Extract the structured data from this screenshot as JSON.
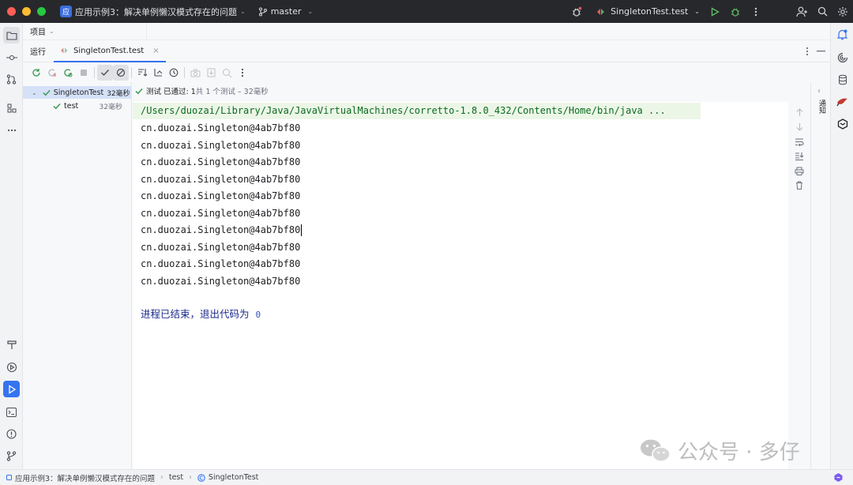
{
  "titlebar": {
    "project_badge": "应",
    "project_name": "应用示例3：解决单例懒汉模式存在的问题",
    "branch": "master",
    "run_config": "SingletonTest.test"
  },
  "project_panel": {
    "label": "项目"
  },
  "run_panel": {
    "label": "运行",
    "tab_label": "SingletonTest.test",
    "tab_close": "×"
  },
  "test_tree": [
    {
      "name": "SingletonTest",
      "time": "32毫秒"
    },
    {
      "name": "test",
      "time": "32毫秒"
    }
  ],
  "summary": {
    "status": "测试 已通过: 1",
    "detail": "共 1 个测试 – 32毫秒"
  },
  "console": {
    "command": "/Users/duozai/Library/Java/JavaVirtualMachines/corretto-1.8.0_432/Contents/Home/bin/java ...",
    "lines": [
      "cn.duozai.Singleton@4ab7bf80",
      "cn.duozai.Singleton@4ab7bf80",
      "cn.duozai.Singleton@4ab7bf80",
      "cn.duozai.Singleton@4ab7bf80",
      "cn.duozai.Singleton@4ab7bf80",
      "cn.duozai.Singleton@4ab7bf80",
      "cn.duozai.Singleton@4ab7bf80",
      "cn.duozai.Singleton@4ab7bf80",
      "cn.duozai.Singleton@4ab7bf80",
      "cn.duozai.Singleton@4ab7bf80"
    ],
    "exit_text": "进程已结束，退出代码为",
    "exit_code": "0"
  },
  "right_strip_label": "通知",
  "statusbar": {
    "crumbs": [
      "应用示例3：解决单例懒汉模式存在的问题",
      "test",
      "SingletonTest"
    ]
  },
  "watermark": {
    "text": "公众号 · 多仔"
  },
  "colors": {
    "titlebar_bg": "#27282c",
    "accent": "#3574f0",
    "pass_green": "#3a9b52",
    "command_bg": "#ecf6e7",
    "exit_text": "#1d2c8e"
  },
  "icons": [
    "folder-icon",
    "commit-icon",
    "pull-request-icon",
    "structure-icon",
    "more-icon",
    "build-icon",
    "services-icon",
    "run-icon",
    "terminal-icon",
    "problems-icon",
    "git-icon",
    "notifications-icon",
    "ai-assistant-icon",
    "database-icon",
    "maven-icon",
    "gradle-icon",
    "bug-icon",
    "play-icon",
    "debug-icon",
    "add-user-icon",
    "search-icon",
    "settings-icon"
  ]
}
